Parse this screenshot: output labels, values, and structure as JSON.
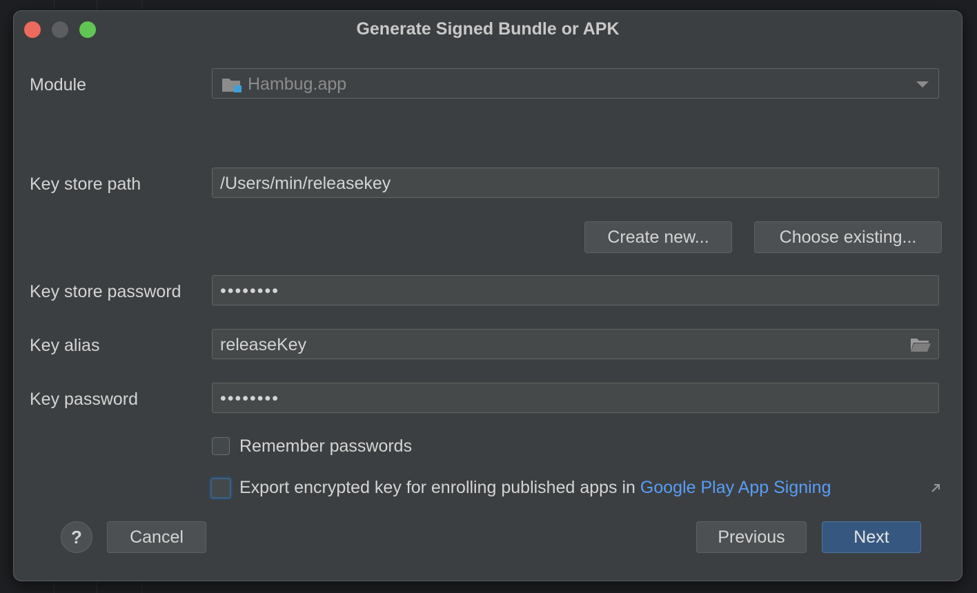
{
  "dialog": {
    "title": "Generate Signed Bundle or APK"
  },
  "module": {
    "label": "Module",
    "value": "Hambug.app"
  },
  "key_store_path": {
    "label": "Key store path",
    "value": "/Users/min/releasekey"
  },
  "key_store_buttons": {
    "create_new": "Create new...",
    "choose_existing": "Choose existing..."
  },
  "key_store_password": {
    "label": "Key store password",
    "value": "••••••••"
  },
  "key_alias": {
    "label": "Key alias",
    "value": "releaseKey"
  },
  "key_password": {
    "label": "Key password",
    "value": "••••••••"
  },
  "remember_passwords": {
    "label": "Remember passwords",
    "checked": false
  },
  "export_key": {
    "label": "Export encrypted key for enrolling published apps in",
    "link": "Google Play App Signing",
    "checked": false
  },
  "footer": {
    "help": "?",
    "cancel": "Cancel",
    "previous": "Previous",
    "next": "Next"
  },
  "colors": {
    "dialog_bg": "#3c3f41",
    "primary_button": "#365880",
    "link": "#589df6"
  }
}
